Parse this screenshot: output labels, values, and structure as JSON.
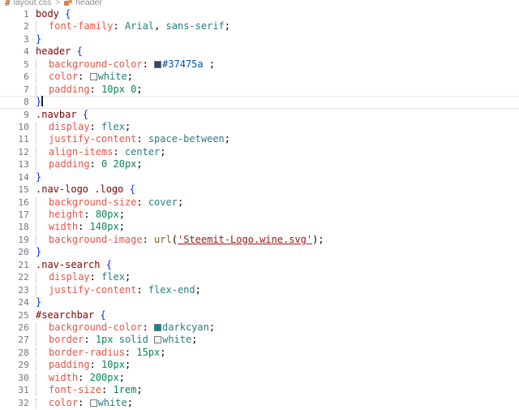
{
  "breadcrumb": {
    "file_icon": "#",
    "file_name": "layout.css",
    "separator": ">",
    "symbol_icon": "css-rule-icon",
    "symbol_name": "header"
  },
  "editor": {
    "language": "css",
    "active_line": 8,
    "cursor_line": 8,
    "cursor_column": 2,
    "first_visible_line": 1,
    "last_visible_line": 32,
    "colors": {
      "selector": "#800000",
      "property": "#e45649",
      "value_keyword": "#2a7d7d",
      "number": "#098658",
      "string": "#a31515",
      "function": "#795e26",
      "hex_value": "#0451a5",
      "brace": "#0431fa",
      "line_number": "#6e7681",
      "background": "#ffffff",
      "active_line_border": "#e8e8e8",
      "indent_guide": "#d3d3d3"
    },
    "swatches": [
      {
        "line": 5,
        "color": "#37475a",
        "label": "#37475a"
      },
      {
        "line": 6,
        "color": "#ffffff",
        "label": "white"
      },
      {
        "line": 26,
        "color": "#008b8b",
        "label": "darkcyan"
      },
      {
        "line": 27,
        "color": "#ffffff",
        "label": "white"
      },
      {
        "line": 32,
        "color": "#ffffff",
        "label": "white"
      }
    ],
    "lines": [
      {
        "n": 1,
        "indent": 0,
        "text": "body {"
      },
      {
        "n": 2,
        "indent": 1,
        "text": "font-family: Arial, sans-serif;"
      },
      {
        "n": 3,
        "indent": 0,
        "text": "}"
      },
      {
        "n": 4,
        "indent": 0,
        "text": "header {"
      },
      {
        "n": 5,
        "indent": 1,
        "text": "background-color: #37475a ;"
      },
      {
        "n": 6,
        "indent": 1,
        "text": "color: white;"
      },
      {
        "n": 7,
        "indent": 1,
        "text": "padding: 10px 0;"
      },
      {
        "n": 8,
        "indent": 0,
        "text": "}"
      },
      {
        "n": 9,
        "indent": 0,
        "text": ".navbar {"
      },
      {
        "n": 10,
        "indent": 1,
        "text": "display: flex;"
      },
      {
        "n": 11,
        "indent": 1,
        "text": "justify-content: space-between;"
      },
      {
        "n": 12,
        "indent": 1,
        "text": "align-items: center;"
      },
      {
        "n": 13,
        "indent": 1,
        "text": "padding: 0 20px;"
      },
      {
        "n": 14,
        "indent": 0,
        "text": "}"
      },
      {
        "n": 15,
        "indent": 0,
        "text": ".nav-logo .logo {"
      },
      {
        "n": 16,
        "indent": 1,
        "text": "background-size: cover;"
      },
      {
        "n": 17,
        "indent": 1,
        "text": "height: 80px;"
      },
      {
        "n": 18,
        "indent": 1,
        "text": "width: 140px;"
      },
      {
        "n": 19,
        "indent": 1,
        "text": "background-image: url('Steemit-Logo.wine.svg');"
      },
      {
        "n": 20,
        "indent": 0,
        "text": "}"
      },
      {
        "n": 21,
        "indent": 0,
        "text": ".nav-search {"
      },
      {
        "n": 22,
        "indent": 1,
        "text": "display: flex;"
      },
      {
        "n": 23,
        "indent": 1,
        "text": "justify-content: flex-end;"
      },
      {
        "n": 24,
        "indent": 0,
        "text": "}"
      },
      {
        "n": 25,
        "indent": 0,
        "text": "#searchbar {"
      },
      {
        "n": 26,
        "indent": 1,
        "text": "background-color: darkcyan;"
      },
      {
        "n": 27,
        "indent": 1,
        "text": "border: 1px solid white;"
      },
      {
        "n": 28,
        "indent": 1,
        "text": "border-radius: 15px;"
      },
      {
        "n": 29,
        "indent": 1,
        "text": "padding: 10px;"
      },
      {
        "n": 30,
        "indent": 1,
        "text": "width: 200px;"
      },
      {
        "n": 31,
        "indent": 1,
        "text": "font-size: 1rem;"
      },
      {
        "n": 32,
        "indent": 1,
        "text": "color: white;"
      }
    ],
    "tokens": {
      "l1": [
        [
          "t-sel",
          "body"
        ],
        [
          "t-punct",
          " "
        ],
        [
          "t-brace",
          "{"
        ]
      ],
      "l2": [
        [
          "t-prop",
          "font-family"
        ],
        [
          "t-punct",
          ": "
        ],
        [
          "t-val",
          "Arial"
        ],
        [
          "t-punct",
          ", "
        ],
        [
          "t-val",
          "sans-serif"
        ],
        [
          "t-punct",
          ";"
        ]
      ],
      "l3": [
        [
          "t-brace",
          "}"
        ]
      ],
      "l4": [
        [
          "t-sel",
          "header"
        ],
        [
          "t-punct",
          " "
        ],
        [
          "t-brace",
          "{"
        ]
      ],
      "l5": [
        [
          "t-prop",
          "background-color"
        ],
        [
          "t-punct",
          ": "
        ],
        [
          "swatch",
          "#37475a"
        ],
        [
          "t-hex",
          "#37475a"
        ],
        [
          "t-punct",
          " ;"
        ]
      ],
      "l6": [
        [
          "t-prop",
          "color"
        ],
        [
          "t-punct",
          ": "
        ],
        [
          "swatch",
          "#ffffff"
        ],
        [
          "t-val",
          "white"
        ],
        [
          "t-punct",
          ";"
        ]
      ],
      "l7": [
        [
          "t-prop",
          "padding"
        ],
        [
          "t-punct",
          ": "
        ],
        [
          "t-num",
          "10px"
        ],
        [
          "t-punct",
          " "
        ],
        [
          "t-num",
          "0"
        ],
        [
          "t-punct",
          ";"
        ]
      ],
      "l8": [
        [
          "t-brace",
          "}"
        ],
        [
          "cursor",
          ""
        ]
      ],
      "l9": [
        [
          "t-sel",
          ".navbar"
        ],
        [
          "t-punct",
          " "
        ],
        [
          "t-brace",
          "{"
        ]
      ],
      "l10": [
        [
          "t-prop",
          "display"
        ],
        [
          "t-punct",
          ": "
        ],
        [
          "t-val",
          "flex"
        ],
        [
          "t-punct",
          ";"
        ]
      ],
      "l11": [
        [
          "t-prop",
          "justify-content"
        ],
        [
          "t-punct",
          ": "
        ],
        [
          "t-val",
          "space-between"
        ],
        [
          "t-punct",
          ";"
        ]
      ],
      "l12": [
        [
          "t-prop",
          "align-items"
        ],
        [
          "t-punct",
          ": "
        ],
        [
          "t-val",
          "center"
        ],
        [
          "t-punct",
          ";"
        ]
      ],
      "l13": [
        [
          "t-prop",
          "padding"
        ],
        [
          "t-punct",
          ": "
        ],
        [
          "t-num",
          "0"
        ],
        [
          "t-punct",
          " "
        ],
        [
          "t-num",
          "20px"
        ],
        [
          "t-punct",
          ";"
        ]
      ],
      "l14": [
        [
          "t-brace",
          "}"
        ]
      ],
      "l15": [
        [
          "t-sel",
          ".nav-logo .logo"
        ],
        [
          "t-punct",
          " "
        ],
        [
          "t-brace",
          "{"
        ]
      ],
      "l16": [
        [
          "t-prop",
          "background-size"
        ],
        [
          "t-punct",
          ": "
        ],
        [
          "t-val",
          "cover"
        ],
        [
          "t-punct",
          ";"
        ]
      ],
      "l17": [
        [
          "t-prop",
          "height"
        ],
        [
          "t-punct",
          ": "
        ],
        [
          "t-num",
          "80px"
        ],
        [
          "t-punct",
          ";"
        ]
      ],
      "l18": [
        [
          "t-prop",
          "width"
        ],
        [
          "t-punct",
          ": "
        ],
        [
          "t-num",
          "140px"
        ],
        [
          "t-punct",
          ";"
        ]
      ],
      "l19": [
        [
          "t-prop",
          "background-image"
        ],
        [
          "t-punct",
          ": "
        ],
        [
          "t-fn",
          "url"
        ],
        [
          "t-punct",
          "("
        ],
        [
          "t-link",
          "'Steemit-Logo.wine.svg'"
        ],
        [
          "t-punct",
          ");"
        ]
      ],
      "l20": [
        [
          "t-brace",
          "}"
        ]
      ],
      "l21": [
        [
          "t-sel",
          ".nav-search"
        ],
        [
          "t-punct",
          " "
        ],
        [
          "t-brace",
          "{"
        ]
      ],
      "l22": [
        [
          "t-prop",
          "display"
        ],
        [
          "t-punct",
          ": "
        ],
        [
          "t-val",
          "flex"
        ],
        [
          "t-punct",
          ";"
        ]
      ],
      "l23": [
        [
          "t-prop",
          "justify-content"
        ],
        [
          "t-punct",
          ": "
        ],
        [
          "t-val",
          "flex-end"
        ],
        [
          "t-punct",
          ";"
        ]
      ],
      "l24": [
        [
          "t-brace",
          "}"
        ]
      ],
      "l25": [
        [
          "t-id",
          "#searchbar"
        ],
        [
          "t-punct",
          " "
        ],
        [
          "t-brace",
          "{"
        ]
      ],
      "l26": [
        [
          "t-prop",
          "background-color"
        ],
        [
          "t-punct",
          ": "
        ],
        [
          "swatch",
          "#008b8b"
        ],
        [
          "t-val",
          "darkcyan"
        ],
        [
          "t-punct",
          ";"
        ]
      ],
      "l27": [
        [
          "t-prop",
          "border"
        ],
        [
          "t-punct",
          ": "
        ],
        [
          "t-num",
          "1px"
        ],
        [
          "t-punct",
          " "
        ],
        [
          "t-val",
          "solid"
        ],
        [
          "t-punct",
          " "
        ],
        [
          "swatch",
          "#ffffff"
        ],
        [
          "t-val",
          "white"
        ],
        [
          "t-punct",
          ";"
        ]
      ],
      "l28": [
        [
          "t-prop",
          "border-radius"
        ],
        [
          "t-punct",
          ": "
        ],
        [
          "t-num",
          "15px"
        ],
        [
          "t-punct",
          ";"
        ]
      ],
      "l29": [
        [
          "t-prop",
          "padding"
        ],
        [
          "t-punct",
          ": "
        ],
        [
          "t-num",
          "10px"
        ],
        [
          "t-punct",
          ";"
        ]
      ],
      "l30": [
        [
          "t-prop",
          "width"
        ],
        [
          "t-punct",
          ": "
        ],
        [
          "t-num",
          "200px"
        ],
        [
          "t-punct",
          ";"
        ]
      ],
      "l31": [
        [
          "t-prop",
          "font-size"
        ],
        [
          "t-punct",
          ": "
        ],
        [
          "t-num",
          "1rem"
        ],
        [
          "t-punct",
          ";"
        ]
      ],
      "l32": [
        [
          "t-prop",
          "color"
        ],
        [
          "t-punct",
          ": "
        ],
        [
          "swatch",
          "#ffffff"
        ],
        [
          "t-val",
          "white"
        ],
        [
          "t-punct",
          ";"
        ]
      ]
    }
  }
}
